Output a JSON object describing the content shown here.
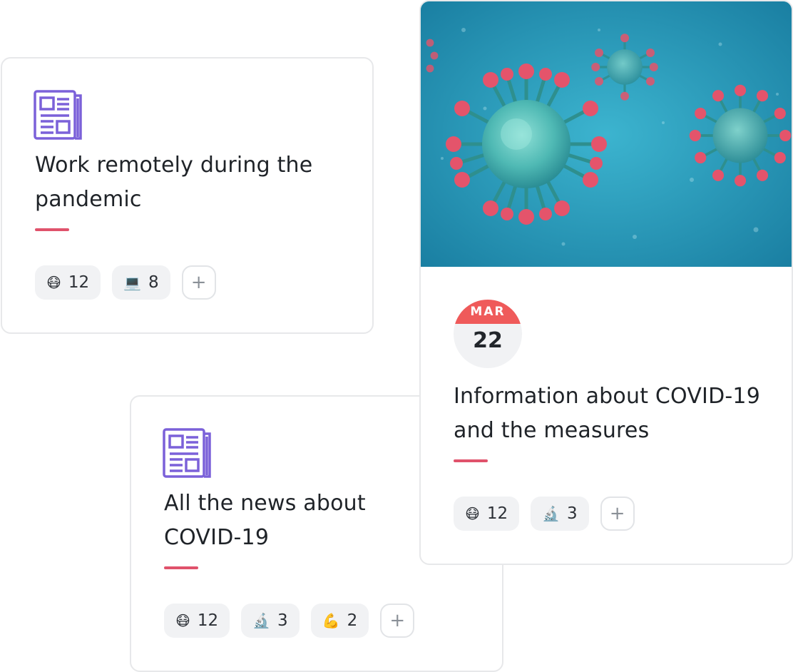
{
  "cards": [
    {
      "title": "Work remotely during the pandemic",
      "icon": "newspaper-icon",
      "reactions": [
        {
          "emoji": "😷",
          "icon": "face-mask-icon",
          "count": "12"
        },
        {
          "emoji": "💻",
          "icon": "laptop-icon",
          "count": "8"
        }
      ],
      "add_label": "+"
    },
    {
      "title": "All the news about COVID-19",
      "icon": "newspaper-icon",
      "reactions": [
        {
          "emoji": "😷",
          "icon": "face-mask-icon",
          "count": "12"
        },
        {
          "emoji": "🔬",
          "icon": "microscope-icon",
          "count": "3"
        },
        {
          "emoji": "💪",
          "icon": "flexed-biceps-icon",
          "count": "2"
        }
      ],
      "add_label": "+"
    },
    {
      "title": "Information about COVID-19 and the measures",
      "image": "coronavirus-image",
      "date": {
        "month": "MAR",
        "day": "22"
      },
      "reactions": [
        {
          "emoji": "😷",
          "icon": "face-mask-icon",
          "count": "12"
        },
        {
          "emoji": "🔬",
          "icon": "microscope-icon",
          "count": "3"
        }
      ],
      "add_label": "+"
    }
  ],
  "colors": {
    "accent_line": "#e0526b",
    "icon_purple": "#7b61d9",
    "date_red": "#ef5a5a",
    "chip_bg": "#f1f2f4",
    "hero_teal": "#2a9fbf",
    "virus_red": "#e4546b",
    "virus_teal": "#5cc6c2"
  }
}
